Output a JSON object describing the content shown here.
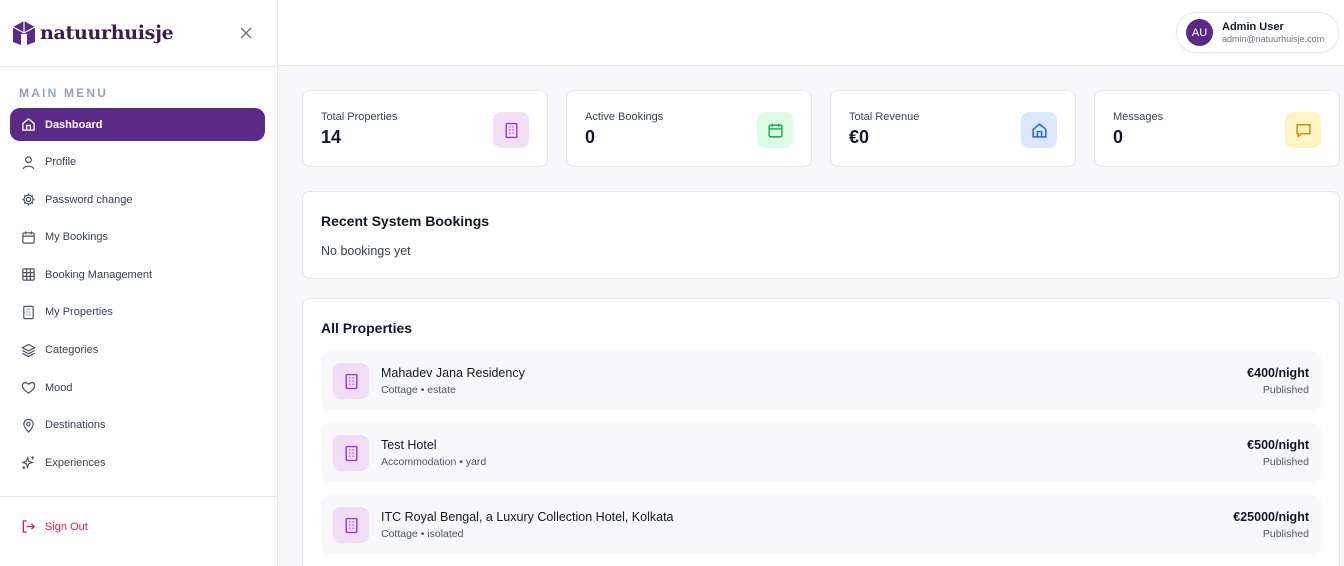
{
  "brand": {
    "name": "natuurhuisje",
    "color": "#5b2a86"
  },
  "sidebar": {
    "heading": "MAIN MENU",
    "items": [
      {
        "label": "Dashboard",
        "icon": "home-icon",
        "active": true
      },
      {
        "label": "Profile",
        "icon": "user-icon"
      },
      {
        "label": "Password change",
        "icon": "gear-icon"
      },
      {
        "label": "My Bookings",
        "icon": "calendar-icon"
      },
      {
        "label": "Booking Management",
        "icon": "grid-icon"
      },
      {
        "label": "My Properties",
        "icon": "building-icon"
      },
      {
        "label": "Categories",
        "icon": "layers-icon"
      },
      {
        "label": "Mood",
        "icon": "heart-icon"
      },
      {
        "label": "Destinations",
        "icon": "map-pin-icon"
      },
      {
        "label": "Experiences",
        "icon": "sparkles-icon"
      }
    ],
    "signout_label": "Sign Out"
  },
  "header": {
    "user": {
      "initials": "AU",
      "name": "Admin User",
      "email": "admin@natuurhuisje.com"
    }
  },
  "stats": [
    {
      "label": "Total Properties",
      "value": "14",
      "icon": "building-icon",
      "bg": "#f3dff7",
      "color": "#9333ea"
    },
    {
      "label": "Active Bookings",
      "value": "0",
      "icon": "calendar-icon",
      "bg": "#dcfce7",
      "color": "#16a34a"
    },
    {
      "label": "Total Revenue",
      "value": "€0",
      "icon": "home-icon",
      "bg": "#dbe8fb",
      "color": "#2563eb"
    },
    {
      "label": "Messages",
      "value": "0",
      "icon": "message-icon",
      "bg": "#fdf4c4",
      "color": "#ca8a04"
    }
  ],
  "recent_bookings": {
    "title": "Recent System Bookings",
    "empty": "No bookings yet"
  },
  "all_properties": {
    "title": "All Properties",
    "items": [
      {
        "name": "Mahadev Jana Residency",
        "meta": "Cottage • estate",
        "price": "€400/night",
        "status": "Published"
      },
      {
        "name": "Test Hotel",
        "meta": "Accommodation • yard",
        "price": "€500/night",
        "status": "Published"
      },
      {
        "name": "ITC Royal Bengal, a Luxury Collection Hotel, Kolkata",
        "meta": "Cottage • isolated",
        "price": "€25000/night",
        "status": "Published"
      }
    ]
  }
}
